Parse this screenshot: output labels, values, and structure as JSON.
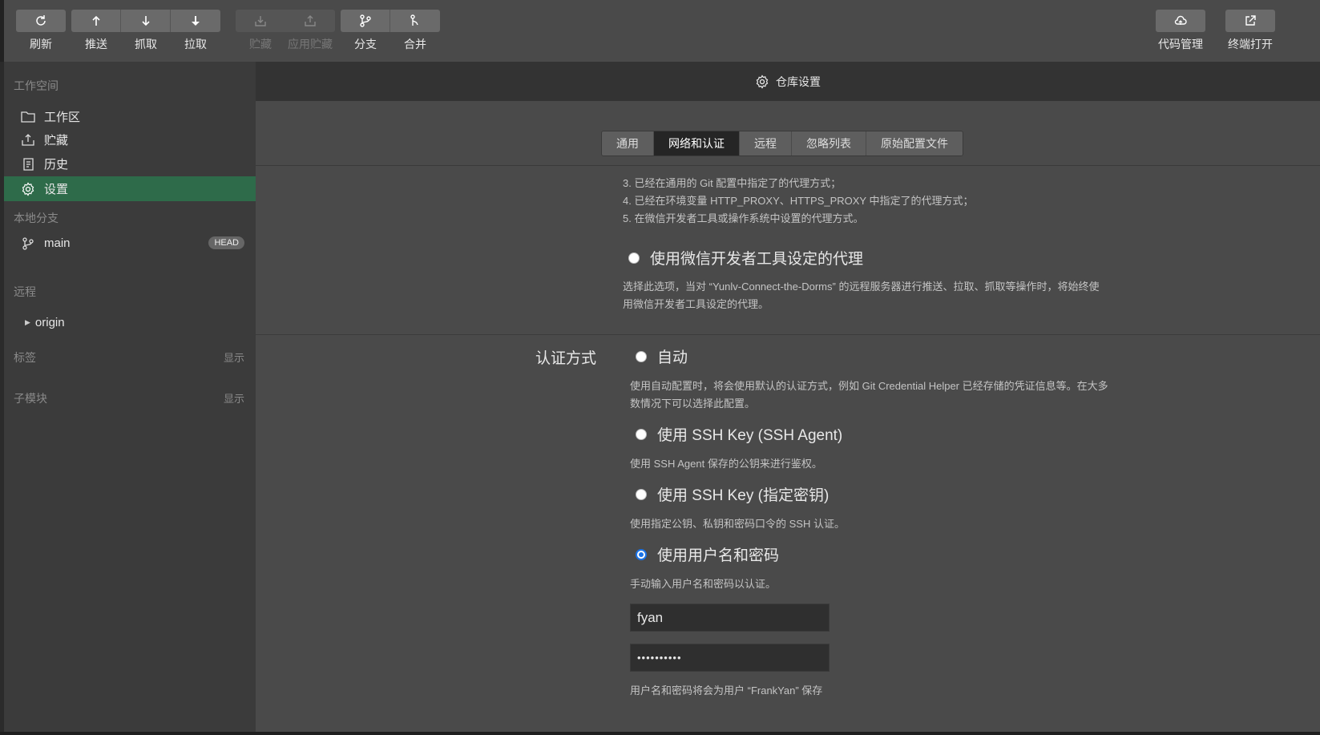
{
  "toolbar": {
    "groups": [
      [
        {
          "label": "刷新",
          "icon": "refresh-icon",
          "enabled": true
        }
      ],
      [
        {
          "label": "推送",
          "icon": "push-icon",
          "enabled": true
        },
        {
          "label": "抓取",
          "icon": "fetch-icon",
          "enabled": true
        },
        {
          "label": "拉取",
          "icon": "pull-icon",
          "enabled": true
        }
      ],
      [
        {
          "label": "贮藏",
          "icon": "stash-icon",
          "enabled": false
        },
        {
          "label": "应用贮藏",
          "icon": "apply-stash-icon",
          "enabled": false
        }
      ],
      [
        {
          "label": "分支",
          "icon": "branch-icon",
          "enabled": true
        },
        {
          "label": "合并",
          "icon": "merge-icon",
          "enabled": true
        }
      ]
    ],
    "right": [
      {
        "label": "代码管理",
        "icon": "cloud-icon"
      },
      {
        "label": "终端打开",
        "icon": "external-link-icon"
      }
    ]
  },
  "sidebar": {
    "workspace_title": "工作空间",
    "items": [
      {
        "label": "工作区",
        "icon": "folder-icon"
      },
      {
        "label": "贮藏",
        "icon": "stash-icon"
      },
      {
        "label": "历史",
        "icon": "history-icon"
      },
      {
        "label": "设置",
        "icon": "gear-icon",
        "active": true
      }
    ],
    "local_branches_title": "本地分支",
    "branch": {
      "name": "main",
      "badge": "HEAD"
    },
    "remote_title": "远程",
    "remote": {
      "name": "origin"
    },
    "tags_title": "标签",
    "tags_show": "显示",
    "submodules_title": "子模块",
    "submodules_show": "显示"
  },
  "main": {
    "title": "仓库设置",
    "tabs": [
      "通用",
      "网络和认证",
      "远程",
      "忽略列表",
      "原始配置文件"
    ],
    "active_tab": 1,
    "proxy_notes": [
      "3. 已经在通用的 Git 配置中指定了的代理方式；",
      "4. 已经在环境变量 HTTP_PROXY、HTTPS_PROXY 中指定了的代理方式；",
      "5. 在微信开发者工具或操作系统中设置的代理方式。"
    ],
    "proxy_option": {
      "label": "使用微信开发者工具设定的代理",
      "desc1": "选择此选项，当对 “Yunlv-Connect-the-Dorms” 的远程服务器进行推送、拉取、抓取等操作时，将始终使",
      "desc2": "用微信开发者工具设定的代理。"
    },
    "auth": {
      "label": "认证方式",
      "options": [
        {
          "label": "自动",
          "desc": [
            "使用自动配置时，将会使用默认的认证方式，例如 Git Credential Helper 已经存储的凭证信息等。在大多",
            "数情况下可以选择此配置。"
          ],
          "checked": false
        },
        {
          "label": "使用 SSH Key (SSH Agent)",
          "desc": [
            "使用 SSH Agent 保存的公钥来进行鉴权。"
          ],
          "checked": false
        },
        {
          "label": "使用 SSH Key (指定密钥)",
          "desc": [
            "使用指定公钥、私钥和密码口令的 SSH 认证。"
          ],
          "checked": false
        },
        {
          "label": "使用用户名和密码",
          "desc": [
            "手动输入用户名和密码以认证。"
          ],
          "checked": true
        }
      ],
      "username": "fyan",
      "password_mask": "••••••••••",
      "save_note": "用户名和密码将会为用户 “FrankYan” 保存"
    }
  },
  "colors": {
    "active_sidebar": "#2e6b4a",
    "radio_accent": "#1a73e8"
  }
}
